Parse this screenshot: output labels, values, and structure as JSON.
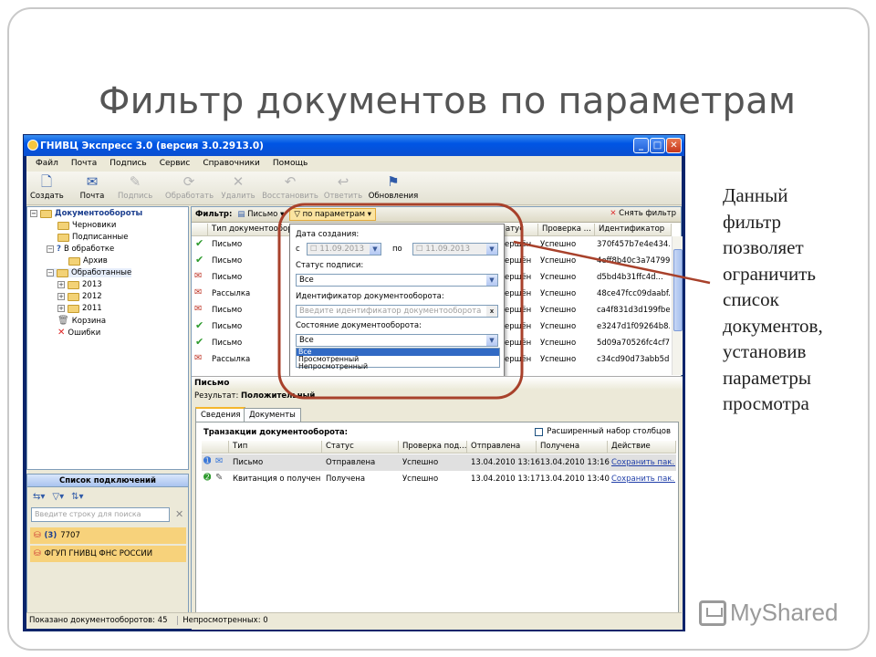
{
  "slide": {
    "title": "Фильтр документов по параметрам",
    "note_lines": [
      "Данный",
      "фильтр",
      "позволяет",
      "ограничить",
      "список",
      "документов,",
      "установив",
      "параметры",
      "просмотра"
    ],
    "watermark": "MyShared"
  },
  "window": {
    "title": "ГНИВЦ Экспресс 3.0 (версия 3.0.2913.0)",
    "controls": [
      "_",
      "□",
      "✕"
    ]
  },
  "menu": [
    "Файл",
    "Почта",
    "Подпись",
    "Сервис",
    "Справочники",
    "Помощь"
  ],
  "toolbar": [
    {
      "label": "Создать",
      "icon": "new-doc-icon",
      "glyph": "🗋",
      "enabled": true
    },
    {
      "label": "Почта",
      "icon": "mail-icon",
      "glyph": "✉",
      "enabled": true
    },
    {
      "label": "Подпись",
      "icon": "sign-icon",
      "glyph": "✎",
      "enabled": false
    },
    {
      "label": "Обработать",
      "icon": "process-icon",
      "glyph": "⟳",
      "enabled": false
    },
    {
      "label": "Удалить",
      "icon": "delete-icon",
      "glyph": "✕",
      "enabled": false
    },
    {
      "label": "Восстановить",
      "icon": "restore-icon",
      "glyph": "↶",
      "enabled": false
    },
    {
      "label": "Ответить",
      "icon": "reply-icon",
      "glyph": "↩",
      "enabled": false
    },
    {
      "label": "Обновления",
      "icon": "updates-icon",
      "glyph": "⚑",
      "enabled": true
    }
  ],
  "tree": {
    "root": "Документообороты",
    "items": [
      "Черновики",
      "Подписанные",
      "В обработке",
      "Архив",
      "Обработанные",
      "2013",
      "2012",
      "2011",
      "Корзина",
      "Ошибки"
    ]
  },
  "connections": {
    "header": "Список подключений",
    "search_placeholder": "Введите строку для поиска",
    "rows": [
      {
        "count": "(3)",
        "name": "7707"
      },
      {
        "name": "ФГУП ГНИВЦ ФНС РОССИИ"
      }
    ]
  },
  "filter": {
    "label": "Фильтр:",
    "doc_filter": "Письмо",
    "param_filter": "по параметрам",
    "reset": "Снять фильтр",
    "panel": {
      "date_label": "Дата создания:",
      "from_label": "с",
      "from_value": "11.09.2013",
      "to_label": "по",
      "to_value": "11.09.2013",
      "sign_status_label": "Статус подписи:",
      "sign_status_value": "Все",
      "id_label": "Идентификатор документооборота:",
      "id_placeholder": "Введите идентификатор документооборота",
      "state_label": "Состояние документооборота:",
      "state_value": "Все",
      "state_options": [
        "Все",
        "Просмотренный",
        "Непросмотренный"
      ]
    }
  },
  "documents": {
    "columns": [
      "Тип документооборо",
      "атус",
      "Проверка ...",
      "Идентификатор"
    ],
    "rows": [
      {
        "type": "Письмо",
        "icon": "check",
        "status": "ершён",
        "check": "Успешно",
        "id": "370f457b7e4e434..."
      },
      {
        "type": "Письмо",
        "icon": "check",
        "status": "ершён",
        "check": "Успешно",
        "id": "4eff8b40c3a74799..."
      },
      {
        "type": "Письмо",
        "icon": "envelope",
        "status": "ершён",
        "check": "Успешно",
        "id": "d5bd4b31ffc4d..."
      },
      {
        "type": "Рассылка",
        "icon": "envelope",
        "status": "ершён",
        "check": "Успешно",
        "id": "48ce47fcc09daabf..."
      },
      {
        "type": "Письмо",
        "icon": "envelope",
        "status": "ершён",
        "check": "Успешно",
        "id": "ca4f831d3d199fbe..."
      },
      {
        "type": "Письмо",
        "icon": "check",
        "status": "ершён",
        "check": "Успешно",
        "id": "e3247d1f09264b8..."
      },
      {
        "type": "Письмо",
        "icon": "check",
        "status": "ершён",
        "check": "Успешно",
        "id": "5d09a70526fc4cf7..."
      },
      {
        "type": "Рассылка",
        "icon": "envelope",
        "status": "ершён",
        "check": "Успешно",
        "id": "c34cd90d73abb5d..."
      }
    ]
  },
  "detail": {
    "title": "Письмо",
    "result_label": "Результат:",
    "result_value": "Положительный",
    "tabs": [
      "Сведения",
      "Документы"
    ],
    "tx_title": "Транзакции документооборота:",
    "ext_columns": "Расширенный набор столбцов",
    "columns": [
      "Тип",
      "Статус",
      "Проверка под...",
      "Отправлена",
      "Получена",
      "Действие"
    ],
    "rows": [
      {
        "type": "Письмо",
        "status": "Отправлена",
        "check": "Успешно",
        "sent": "13.04.2010 13:16",
        "received": "13.04.2010 13:16",
        "action": "Сохранить пак..."
      },
      {
        "type": "Квитанция о получен...",
        "status": "Получена",
        "check": "Успешно",
        "sent": "13.04.2010 13:17",
        "received": "13.04.2010 13:40",
        "action": "Сохранить пак..."
      }
    ]
  },
  "statusbar": {
    "shown_label": "Показано документооборотов: 45",
    "unread_label": "Непросмотренных: 0"
  },
  "colors": {
    "annotation": "#a8412b",
    "titlebar": "#0055e5",
    "selection": "#316ac5"
  }
}
